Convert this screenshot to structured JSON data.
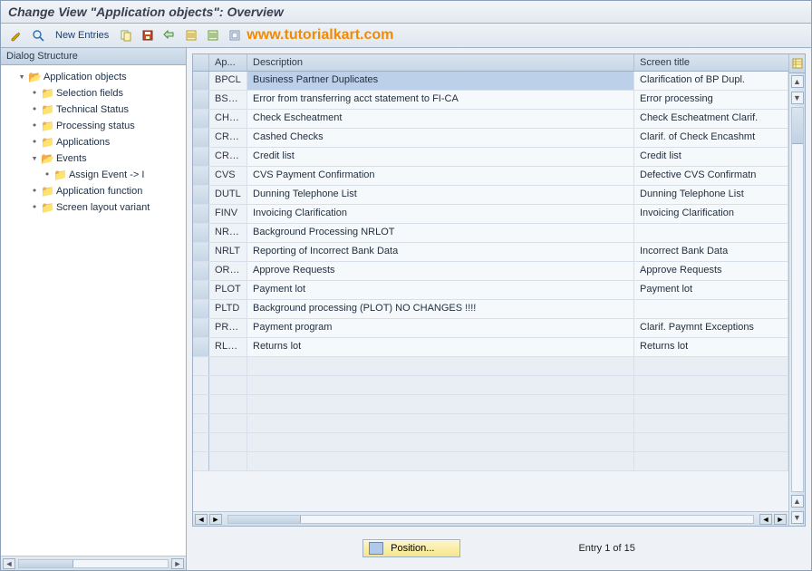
{
  "title": "Change View \"Application objects\": Overview",
  "watermark": "www.tutorialkart.com",
  "toolbar": {
    "new_entries_label": "New Entries"
  },
  "tree": {
    "header": "Dialog Structure",
    "root": {
      "label": "Application objects",
      "children": [
        {
          "label": "Selection fields"
        },
        {
          "label": "Technical Status"
        },
        {
          "label": "Processing status"
        },
        {
          "label": "Applications"
        },
        {
          "label": "Events",
          "expanded": true,
          "children": [
            {
              "label": "Assign Event -> I"
            }
          ]
        },
        {
          "label": "Application function"
        },
        {
          "label": "Screen layout variant"
        }
      ]
    }
  },
  "grid": {
    "columns": {
      "app": "Ap...",
      "desc": "Description",
      "title": "Screen title"
    },
    "rows": [
      {
        "app": "BPCL",
        "desc": "Business Partner Duplicates",
        "title": "Clarification of BP Dupl."
      },
      {
        "app": "BSTM",
        "desc": "Error from transferring acct statement to FI-CA",
        "title": "Error processing"
      },
      {
        "app": "CHES",
        "desc": "Check Escheatment",
        "title": "Check Escheatment Clarif."
      },
      {
        "app": "CRCL",
        "desc": "Cashed Checks",
        "title": "Clarif. of Check Encashmt"
      },
      {
        "app": "CRPO",
        "desc": "Credit list",
        "title": "Credit list"
      },
      {
        "app": "CVS",
        "desc": "CVS Payment Confirmation",
        "title": "Defective CVS Confirmatn"
      },
      {
        "app": "DUTL",
        "desc": "Dunning Telephone List",
        "title": "Dunning Telephone List"
      },
      {
        "app": "FINV",
        "desc": "Invoicing Clarification",
        "title": "Invoicing Clarification"
      },
      {
        "app": "NRLD",
        "desc": "Background Processing NRLOT",
        "title": ""
      },
      {
        "app": "NRLT",
        "desc": "Reporting of Incorrect Bank Data",
        "title": "Incorrect Bank Data"
      },
      {
        "app": "ORDA",
        "desc": "Approve Requests",
        "title": "Approve Requests"
      },
      {
        "app": "PLOT",
        "desc": "Payment lot",
        "title": "Payment lot"
      },
      {
        "app": "PLTD",
        "desc": "Background processing (PLOT) NO CHANGES !!!!",
        "title": ""
      },
      {
        "app": "PRUN",
        "desc": "Payment program",
        "title": "Clarif. Paymnt Exceptions"
      },
      {
        "app": "RLOT",
        "desc": "Returns lot",
        "title": "Returns lot"
      }
    ],
    "empty_rows": 6
  },
  "footer": {
    "position_label": "Position...",
    "entry_text": "Entry 1 of 15"
  }
}
